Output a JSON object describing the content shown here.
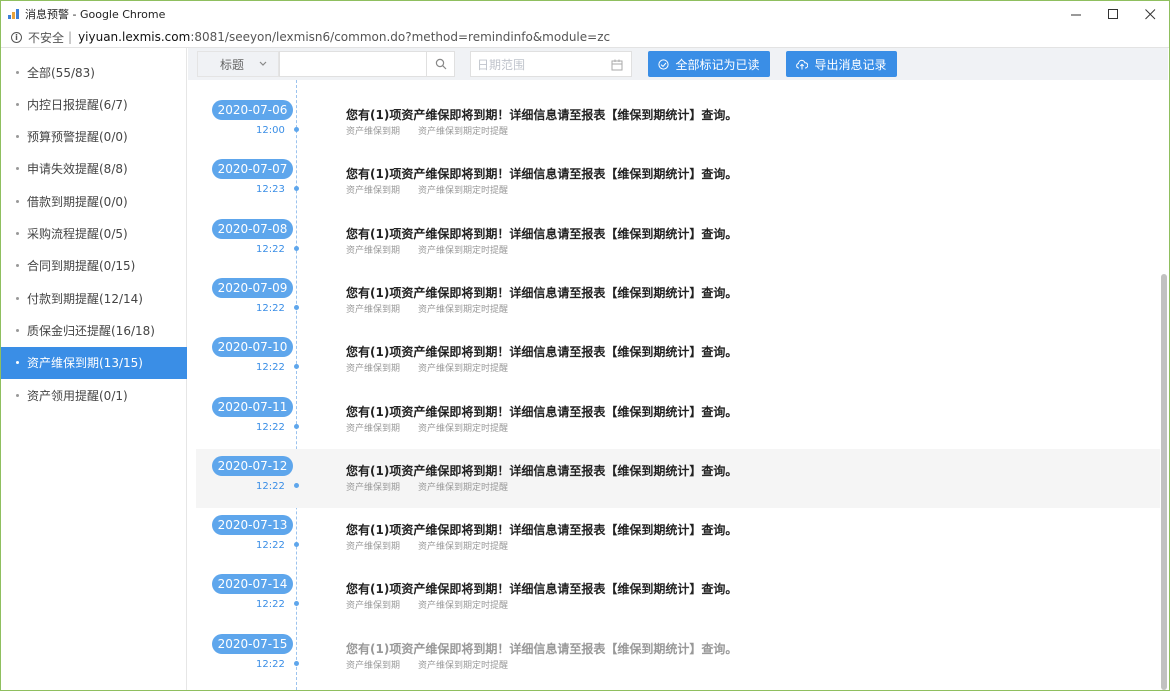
{
  "window": {
    "title": "消息预警 - Google Chrome",
    "insecure_label": "不安全",
    "url_host": "yiyuan.lexmis.com",
    "url_rest": ":8081/seeyon/lexmisn6/common.do?method=remindinfo&module=zc"
  },
  "sidebar": {
    "items": [
      {
        "label": "全部(55/83)"
      },
      {
        "label": "内控日报提醒(6/7)"
      },
      {
        "label": "预算预警提醒(0/0)"
      },
      {
        "label": "申请失效提醒(8/8)"
      },
      {
        "label": "借款到期提醒(0/0)"
      },
      {
        "label": "采购流程提醒(0/5)"
      },
      {
        "label": "合同到期提醒(0/15)"
      },
      {
        "label": "付款到期提醒(12/14)"
      },
      {
        "label": "质保金归还提醒(16/18)"
      },
      {
        "label": "资产维保到期(13/15)"
      },
      {
        "label": "资产领用提醒(0/1)"
      }
    ],
    "active_index": 9
  },
  "toolbar": {
    "select_value": "标题",
    "search_value": "",
    "date_placeholder": "日期范围",
    "mark_all_read_label": "全部标记为已读",
    "export_label": "导出消息记录"
  },
  "colors": {
    "accent": "#3a8ee6",
    "pill": "#5ea6ec"
  },
  "messages": [
    {
      "date": "2020-07-06",
      "time": "12:00",
      "text": "您有(1)项资产维保即将到期！详细信息请至报表【维保到期统计】查询。",
      "tag1": "资产维保到期",
      "tag2": "资产维保到期定时提醒",
      "read": false
    },
    {
      "date": "2020-07-07",
      "time": "12:23",
      "text": "您有(1)项资产维保即将到期！详细信息请至报表【维保到期统计】查询。",
      "tag1": "资产维保到期",
      "tag2": "资产维保到期定时提醒",
      "read": false
    },
    {
      "date": "2020-07-08",
      "time": "12:22",
      "text": "您有(1)项资产维保即将到期！详细信息请至报表【维保到期统计】查询。",
      "tag1": "资产维保到期",
      "tag2": "资产维保到期定时提醒",
      "read": false
    },
    {
      "date": "2020-07-09",
      "time": "12:22",
      "text": "您有(1)项资产维保即将到期！详细信息请至报表【维保到期统计】查询。",
      "tag1": "资产维保到期",
      "tag2": "资产维保到期定时提醒",
      "read": false
    },
    {
      "date": "2020-07-10",
      "time": "12:22",
      "text": "您有(1)项资产维保即将到期！详细信息请至报表【维保到期统计】查询。",
      "tag1": "资产维保到期",
      "tag2": "资产维保到期定时提醒",
      "read": false
    },
    {
      "date": "2020-07-11",
      "time": "12:22",
      "text": "您有(1)项资产维保即将到期！详细信息请至报表【维保到期统计】查询。",
      "tag1": "资产维保到期",
      "tag2": "资产维保到期定时提醒",
      "read": false
    },
    {
      "date": "2020-07-12",
      "time": "12:22",
      "text": "您有(1)项资产维保即将到期！详细信息请至报表【维保到期统计】查询。",
      "tag1": "资产维保到期",
      "tag2": "资产维保到期定时提醒",
      "read": false
    },
    {
      "date": "2020-07-13",
      "time": "12:22",
      "text": "您有(1)项资产维保即将到期！详细信息请至报表【维保到期统计】查询。",
      "tag1": "资产维保到期",
      "tag2": "资产维保到期定时提醒",
      "read": false
    },
    {
      "date": "2020-07-14",
      "time": "12:22",
      "text": "您有(1)项资产维保即将到期！详细信息请至报表【维保到期统计】查询。",
      "tag1": "资产维保到期",
      "tag2": "资产维保到期定时提醒",
      "read": false
    },
    {
      "date": "2020-07-15",
      "time": "12:22",
      "text": "您有(1)项资产维保即将到期！详细信息请至报表【维保到期统计】查询。",
      "tag1": "资产维保到期",
      "tag2": "资产维保到期定时提醒",
      "read": true
    }
  ]
}
